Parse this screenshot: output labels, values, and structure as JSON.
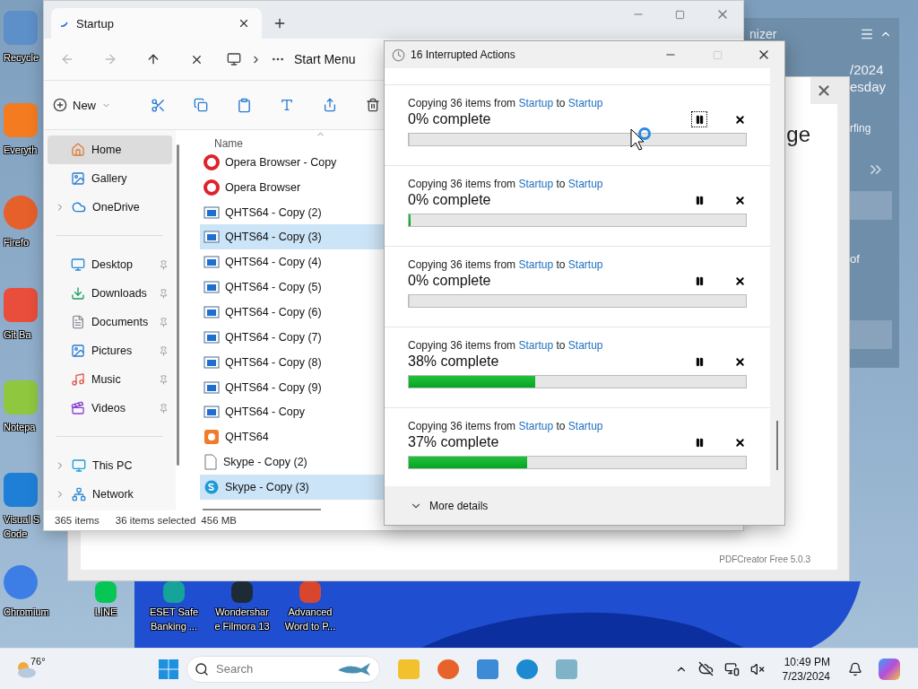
{
  "desktop_icons": [
    {
      "kind": "recycle",
      "label": "Recycle"
    },
    {
      "kind": "search",
      "label": "Everyth"
    },
    {
      "kind": "firefox",
      "label": "Firefo"
    },
    {
      "kind": "git",
      "label": "Git Ba"
    },
    {
      "kind": "notepad",
      "label": "Notepa"
    },
    {
      "kind": "code",
      "label": "Visual S\nCode"
    },
    {
      "kind": "chromium",
      "label": "Chromium"
    }
  ],
  "shortcuts": [
    {
      "kind": "line",
      "label": "LINE"
    },
    {
      "kind": "eset",
      "label": "ESET Safe\nBanking ..."
    },
    {
      "kind": "filmora",
      "label": "Wondershar\ne Filmora 13"
    },
    {
      "kind": "word",
      "label": "Advanced\nWord to P..."
    }
  ],
  "organizer": {
    "title": "nizer",
    "date": "/2024",
    "weekday": "esday",
    "line_1": "rfing",
    "line_2": "of"
  },
  "pdf_window": {
    "heading": "ge",
    "footer": "PDFCreator Free 5.0.3"
  },
  "explorer": {
    "tab": {
      "title": "Startup"
    },
    "address": "Start Menu",
    "toolbar": {
      "new_label": "New"
    },
    "sidebar": [
      [
        {
          "kind": "home",
          "label": "Home",
          "selected": true,
          "expandable": false,
          "pinned": false
        },
        {
          "kind": "gallery",
          "label": "Gallery",
          "selected": false,
          "expandable": false,
          "pinned": false
        },
        {
          "kind": "cloud",
          "label": "OneDrive",
          "selected": false,
          "expandable": true,
          "pinned": false
        }
      ],
      [
        {
          "kind": "desktop",
          "label": "Desktop",
          "selected": false,
          "expandable": false,
          "pinned": true
        },
        {
          "kind": "download",
          "label": "Downloads",
          "selected": false,
          "expandable": false,
          "pinned": true
        },
        {
          "kind": "document",
          "label": "Documents",
          "selected": false,
          "expandable": false,
          "pinned": true
        },
        {
          "kind": "picture",
          "label": "Pictures",
          "selected": false,
          "expandable": false,
          "pinned": true
        },
        {
          "kind": "music",
          "label": "Music",
          "selected": false,
          "expandable": false,
          "pinned": true
        },
        {
          "kind": "video",
          "label": "Videos",
          "selected": false,
          "expandable": false,
          "pinned": true
        }
      ],
      [
        {
          "kind": "pc",
          "label": "This PC",
          "selected": false,
          "expandable": true,
          "pinned": false
        },
        {
          "kind": "network",
          "label": "Network",
          "selected": false,
          "expandable": true,
          "pinned": false
        }
      ]
    ],
    "column": "Name",
    "files": [
      {
        "kind": "opera",
        "name": "Opera Browser - Copy",
        "selected": false
      },
      {
        "kind": "opera",
        "name": "Opera Browser",
        "selected": false
      },
      {
        "kind": "window",
        "name": "QHTS64 - Copy (2)",
        "selected": false
      },
      {
        "kind": "window",
        "name": "QHTS64 - Copy (3)",
        "selected": true
      },
      {
        "kind": "window",
        "name": "QHTS64 - Copy (4)",
        "selected": false
      },
      {
        "kind": "window",
        "name": "QHTS64 - Copy (5)",
        "selected": false
      },
      {
        "kind": "window",
        "name": "QHTS64 - Copy (6)",
        "selected": false
      },
      {
        "kind": "window",
        "name": "QHTS64 - Copy (7)",
        "selected": false
      },
      {
        "kind": "window",
        "name": "QHTS64 - Copy (8)",
        "selected": false
      },
      {
        "kind": "window",
        "name": "QHTS64 - Copy (9)",
        "selected": false
      },
      {
        "kind": "window",
        "name": "QHTS64 - Copy",
        "selected": false
      },
      {
        "kind": "app",
        "name": "QHTS64",
        "selected": false
      },
      {
        "kind": "file",
        "name": "Skype - Copy (2)",
        "selected": false
      },
      {
        "kind": "skype",
        "name": "Skype - Copy (3)",
        "selected": true
      }
    ],
    "status_bar": {
      "count": "365 items",
      "selection": "36 items selected",
      "size": "456 MB"
    }
  },
  "dialog": {
    "title": "16 Interrupted Actions",
    "more_details": "More details",
    "operations": [
      {
        "prefix": "Copying 36 items from",
        "source": "Startup",
        "joiner": "to",
        "destination": "Startup",
        "progress": "0% complete",
        "level": 0,
        "focused": true
      },
      {
        "prefix": "Copying 36 items from",
        "source": "Startup",
        "joiner": "to",
        "destination": "Startup",
        "progress": "0% complete",
        "level": 0.005,
        "focused": false
      },
      {
        "prefix": "Copying 36 items from",
        "source": "Startup",
        "joiner": "to",
        "destination": "Startup",
        "progress": "0% complete",
        "level": 0,
        "focused": false
      },
      {
        "prefix": "Copying 36 items from",
        "source": "Startup",
        "joiner": "to",
        "destination": "Startup",
        "progress": "38% complete",
        "level": 0.375,
        "focused": false
      },
      {
        "prefix": "Copying 36 items from",
        "source": "Startup",
        "joiner": "to",
        "destination": "Startup",
        "progress": "37% complete",
        "level": 0.35,
        "focused": false
      }
    ]
  },
  "taskbar": {
    "temperature": "76°",
    "search_placeholder": "Search",
    "time": "10:49 PM",
    "date": "7/23/2024"
  }
}
